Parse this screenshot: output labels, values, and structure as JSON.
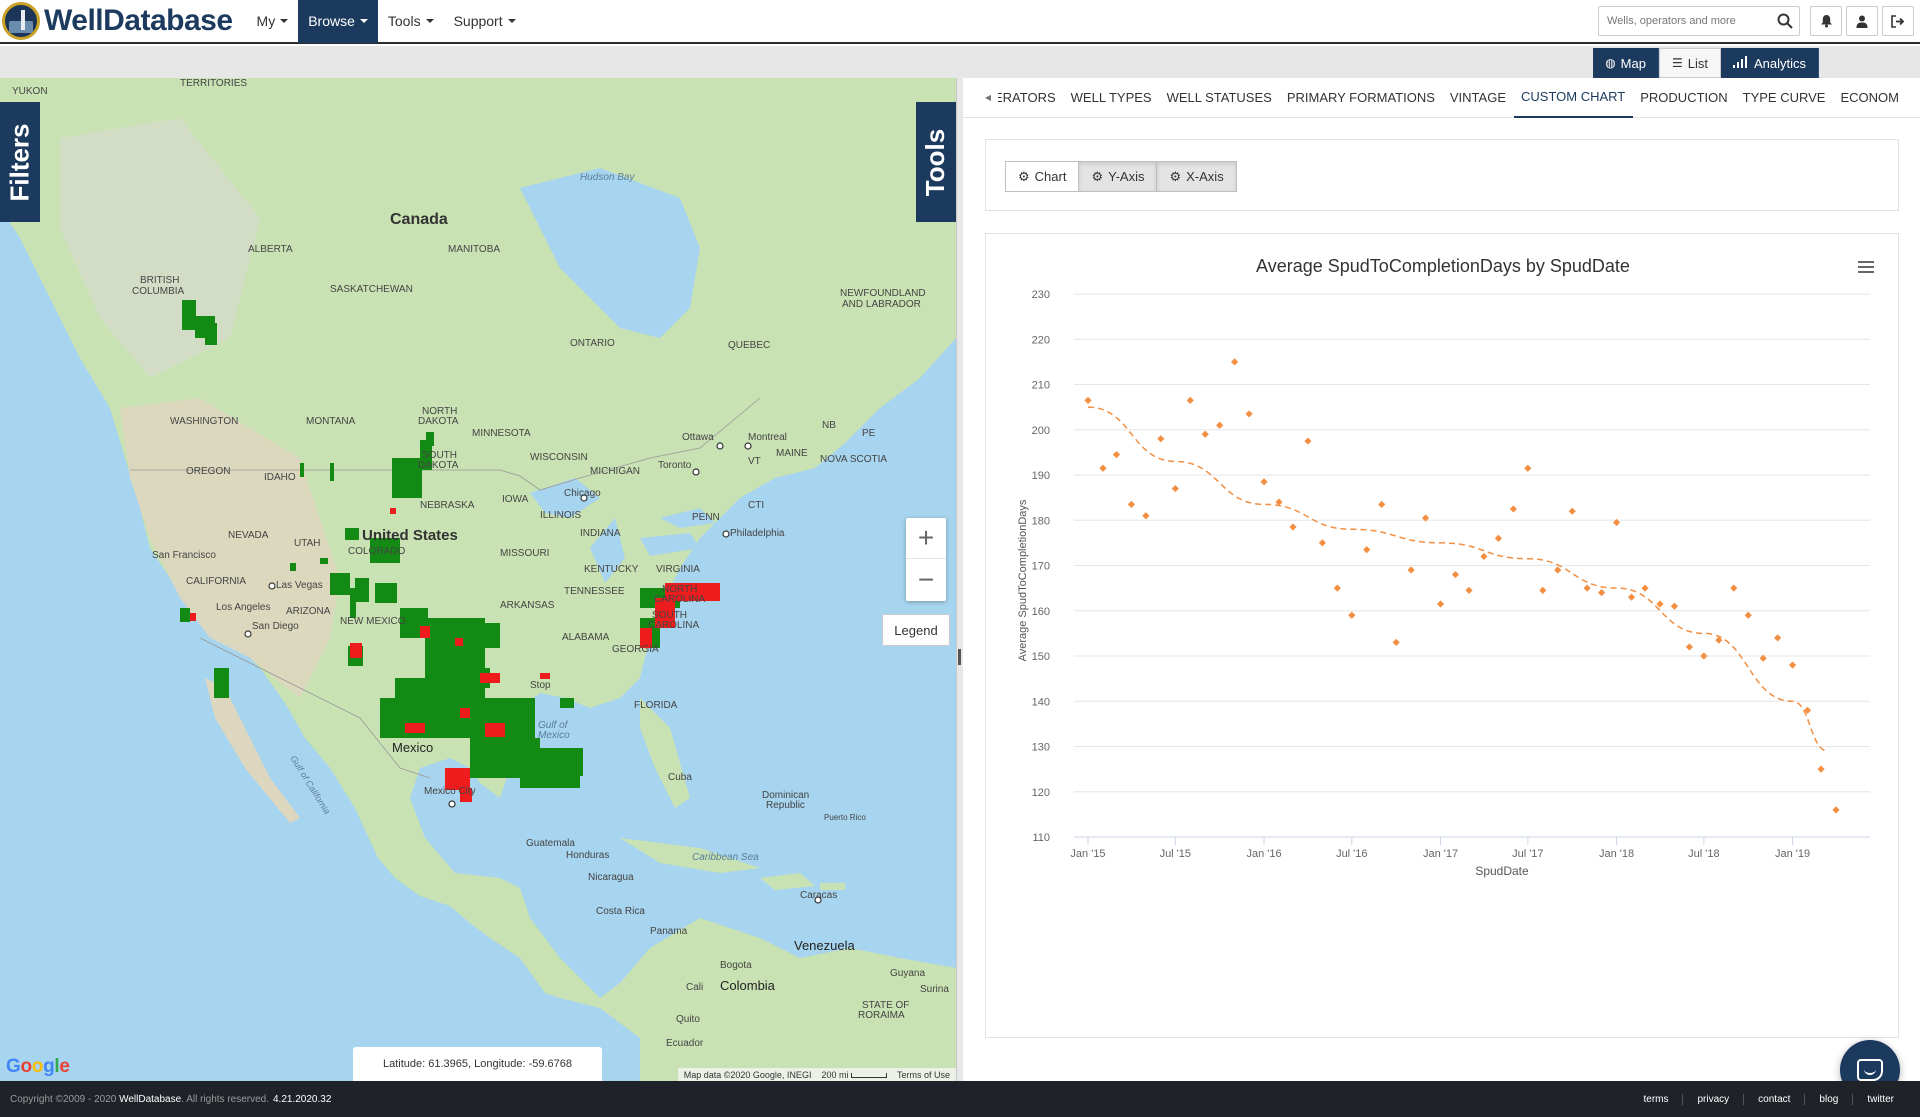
{
  "app": {
    "brand": "WellDatabase",
    "nav": [
      {
        "label": "My"
      },
      {
        "label": "Browse"
      },
      {
        "label": "Tools"
      },
      {
        "label": "Support"
      }
    ],
    "search_placeholder": "Wells, operators and more"
  },
  "view_toggle": {
    "map": "Map",
    "list": "List",
    "analytics": "Analytics"
  },
  "map": {
    "filters_tab": "Filters",
    "tools_tab": "Tools",
    "legend": "Legend",
    "zoom_in": "+",
    "zoom_out": "−",
    "coordinates": "Latitude: 61.3965, Longitude: -59.6768",
    "google": "Google",
    "attribution": {
      "data": "Map data ©2020 Google, INEGI",
      "scale": "200 mi",
      "terms": "Terms of Use"
    },
    "labels": [
      {
        "text": "YUKON"
      },
      {
        "text": "TERRITORIES"
      },
      {
        "text": "Hudson Bay"
      },
      {
        "text": "Canada"
      },
      {
        "text": "ALBERTA"
      },
      {
        "text": "MANITOBA"
      },
      {
        "text": "BRITISH"
      },
      {
        "text": "COLUMBIA"
      },
      {
        "text": "SASKATCHEWAN"
      },
      {
        "text": "NEWFOUNDLAND"
      },
      {
        "text": "AND LABRADOR"
      },
      {
        "text": "ONTARIO"
      },
      {
        "text": "QUEBEC"
      },
      {
        "text": "NORTH"
      },
      {
        "text": "DAKOTA"
      },
      {
        "text": "WASHINGTON"
      },
      {
        "text": "MONTANA"
      },
      {
        "text": "MINNESOTA"
      },
      {
        "text": "Ottawa"
      },
      {
        "text": "Montreal"
      },
      {
        "text": "NB"
      },
      {
        "text": "PE"
      },
      {
        "text": "OREGON"
      },
      {
        "text": "IDAHO"
      },
      {
        "text": "SOUTH"
      },
      {
        "text": "DAKOTA"
      },
      {
        "text": "WISCONSIN"
      },
      {
        "text": "MICHIGAN"
      },
      {
        "text": "Toronto"
      },
      {
        "text": "VT"
      },
      {
        "text": "MAINE"
      },
      {
        "text": "NOVA SCOTIA"
      },
      {
        "text": "Chicago"
      },
      {
        "text": "NEBRASKA"
      },
      {
        "text": "IOWA"
      },
      {
        "text": "NEVADA"
      },
      {
        "text": "UTAH"
      },
      {
        "text": "United States"
      },
      {
        "text": "ILLINOIS"
      },
      {
        "text": "INDIANA"
      },
      {
        "text": "Philadelphia"
      },
      {
        "text": "San Francisco"
      },
      {
        "text": "COLORADO"
      },
      {
        "text": "MISSOURI"
      },
      {
        "text": "KENTUCKY"
      },
      {
        "text": "VIRGINIA"
      },
      {
        "text": "CALIFORNIA"
      },
      {
        "text": "Las Vegas"
      },
      {
        "text": "Los Angeles"
      },
      {
        "text": "ARIZONA"
      },
      {
        "text": "ARKANSAS"
      },
      {
        "text": "TENNESSEE"
      },
      {
        "text": "NORTH"
      },
      {
        "text": "CAROLINA"
      },
      {
        "text": "San Diego"
      },
      {
        "text": "NEW MEXICO"
      },
      {
        "text": "SOUTH"
      },
      {
        "text": "CAROLINA"
      },
      {
        "text": "ALABAMA"
      },
      {
        "text": "GEORGIA"
      },
      {
        "text": "FLORIDA"
      },
      {
        "text": "Gulf of"
      },
      {
        "text": "Mexico"
      },
      {
        "text": "Mexico"
      },
      {
        "text": "Cuba"
      },
      {
        "text": "Mexico City"
      },
      {
        "text": "Dominican"
      },
      {
        "text": "Republic"
      },
      {
        "text": "Puerto Rico"
      },
      {
        "text": "Guatemala"
      },
      {
        "text": "Honduras"
      },
      {
        "text": "Caribbean Sea"
      },
      {
        "text": "Nicaragua"
      },
      {
        "text": "Costa Rica"
      },
      {
        "text": "Caracas"
      },
      {
        "text": "Panama"
      },
      {
        "text": "Venezuela"
      },
      {
        "text": "Bogota"
      },
      {
        "text": "Colombia"
      },
      {
        "text": "Guyana"
      },
      {
        "text": "Cali"
      },
      {
        "text": "Surina"
      },
      {
        "text": "Quito"
      },
      {
        "text": "Ecuador"
      },
      {
        "text": "STATE OF"
      },
      {
        "text": "RORAIMA"
      },
      {
        "text": "Gulf of California"
      },
      {
        "text": "CTI"
      },
      {
        "text": "PENN"
      },
      {
        "text": "Stop"
      }
    ]
  },
  "tabs": {
    "items": [
      "ERATORS",
      "WELL TYPES",
      "WELL STATUSES",
      "PRIMARY FORMATIONS",
      "VINTAGE",
      "CUSTOM CHART",
      "PRODUCTION",
      "TYPE CURVE",
      "ECONOMICS"
    ],
    "active": "CUSTOM CHART"
  },
  "chart_buttons": {
    "chart": "Chart",
    "y_axis": "Y-Axis",
    "x_axis": "X-Axis"
  },
  "chart_data": {
    "type": "scatter",
    "title": "Average SpudToCompletionDays by SpudDate",
    "xlabel": "SpudDate",
    "ylabel": "Average SpudToCompletionDays",
    "y_ticks": [
      110,
      120,
      130,
      140,
      150,
      160,
      170,
      180,
      190,
      200,
      210,
      220,
      230
    ],
    "ylim": [
      110,
      230
    ],
    "x_ticks": [
      "Jan '15",
      "Jul '15",
      "Jan '16",
      "Jul '16",
      "Jan '17",
      "Jul '17",
      "Jan '18",
      "Jul '18",
      "Jan '19"
    ],
    "xlim": [
      "2015-01-01",
      "2019-04-01"
    ],
    "grid": true,
    "legend": "none",
    "point_color": "#f28f43",
    "series": [
      {
        "points": [
          {
            "x": "2015-01-01",
            "y": 206.5
          },
          {
            "x": "2015-02-01",
            "y": 191.5
          },
          {
            "x": "2015-03-01",
            "y": 194.5
          },
          {
            "x": "2015-04-01",
            "y": 183.5
          },
          {
            "x": "2015-05-01",
            "y": 181
          },
          {
            "x": "2015-06-01",
            "y": 198
          },
          {
            "x": "2015-07-01",
            "y": 187
          },
          {
            "x": "2015-08-01",
            "y": 206.5
          },
          {
            "x": "2015-09-01",
            "y": 199
          },
          {
            "x": "2015-10-01",
            "y": 201
          },
          {
            "x": "2015-11-01",
            "y": 215
          },
          {
            "x": "2015-12-01",
            "y": 203.5
          },
          {
            "x": "2016-01-01",
            "y": 188.5
          },
          {
            "x": "2016-02-01",
            "y": 184
          },
          {
            "x": "2016-03-01",
            "y": 178.5
          },
          {
            "x": "2016-04-01",
            "y": 197.5
          },
          {
            "x": "2016-05-01",
            "y": 175
          },
          {
            "x": "2016-06-01",
            "y": 165
          },
          {
            "x": "2016-07-01",
            "y": 159
          },
          {
            "x": "2016-08-01",
            "y": 173.5
          },
          {
            "x": "2016-09-01",
            "y": 183.5
          },
          {
            "x": "2016-10-01",
            "y": 153
          },
          {
            "x": "2016-11-01",
            "y": 169
          },
          {
            "x": "2016-12-01",
            "y": 180.5
          },
          {
            "x": "2017-01-01",
            "y": 161.5
          },
          {
            "x": "2017-02-01",
            "y": 168
          },
          {
            "x": "2017-03-01",
            "y": 164.5
          },
          {
            "x": "2017-04-01",
            "y": 172
          },
          {
            "x": "2017-05-01",
            "y": 176
          },
          {
            "x": "2017-06-01",
            "y": 182.5
          },
          {
            "x": "2017-07-01",
            "y": 191.5
          },
          {
            "x": "2017-08-01",
            "y": 164.5
          },
          {
            "x": "2017-09-01",
            "y": 169
          },
          {
            "x": "2017-10-01",
            "y": 182
          },
          {
            "x": "2017-11-01",
            "y": 165
          },
          {
            "x": "2017-12-01",
            "y": 164
          },
          {
            "x": "2018-01-01",
            "y": 179.5
          },
          {
            "x": "2018-02-01",
            "y": 163
          },
          {
            "x": "2018-03-01",
            "y": 165
          },
          {
            "x": "2018-04-01",
            "y": 161.5
          },
          {
            "x": "2018-05-01",
            "y": 161
          },
          {
            "x": "2018-06-01",
            "y": 152
          },
          {
            "x": "2018-07-01",
            "y": 150
          },
          {
            "x": "2018-08-01",
            "y": 153.5
          },
          {
            "x": "2018-09-01",
            "y": 165
          },
          {
            "x": "2018-10-01",
            "y": 159
          },
          {
            "x": "2018-11-01",
            "y": 149.5
          },
          {
            "x": "2018-12-01",
            "y": 154
          },
          {
            "x": "2019-01-01",
            "y": 148
          },
          {
            "x": "2019-02-01",
            "y": 138
          },
          {
            "x": "2019-03-01",
            "y": 125
          },
          {
            "x": "2019-04-01",
            "y": 116
          }
        ]
      }
    ],
    "trendline": [
      {
        "x": "2015-01-01",
        "y": 205
      },
      {
        "x": "2015-07-01",
        "y": 193
      },
      {
        "x": "2016-01-01",
        "y": 183.5
      },
      {
        "x": "2016-07-01",
        "y": 178
      },
      {
        "x": "2017-01-01",
        "y": 175
      },
      {
        "x": "2017-07-01",
        "y": 171.5
      },
      {
        "x": "2018-01-01",
        "y": 165
      },
      {
        "x": "2018-07-01",
        "y": 155
      },
      {
        "x": "2019-01-01",
        "y": 140
      },
      {
        "x": "2019-03-15",
        "y": 129
      }
    ]
  },
  "footer": {
    "copyright": "Copyright ©2009 - 2020",
    "brand": "WellDatabase",
    "rights": ". All rights reserved.",
    "version": "4.21.2020.32",
    "links": [
      "terms",
      "privacy",
      "contact",
      "blog",
      "twitter"
    ]
  },
  "colors": {
    "primary": "#1c3a5e",
    "well_green": "#138a13",
    "well_red": "#ee1c1c",
    "water": "#a7d4ee",
    "land": "#c8e2b4"
  }
}
